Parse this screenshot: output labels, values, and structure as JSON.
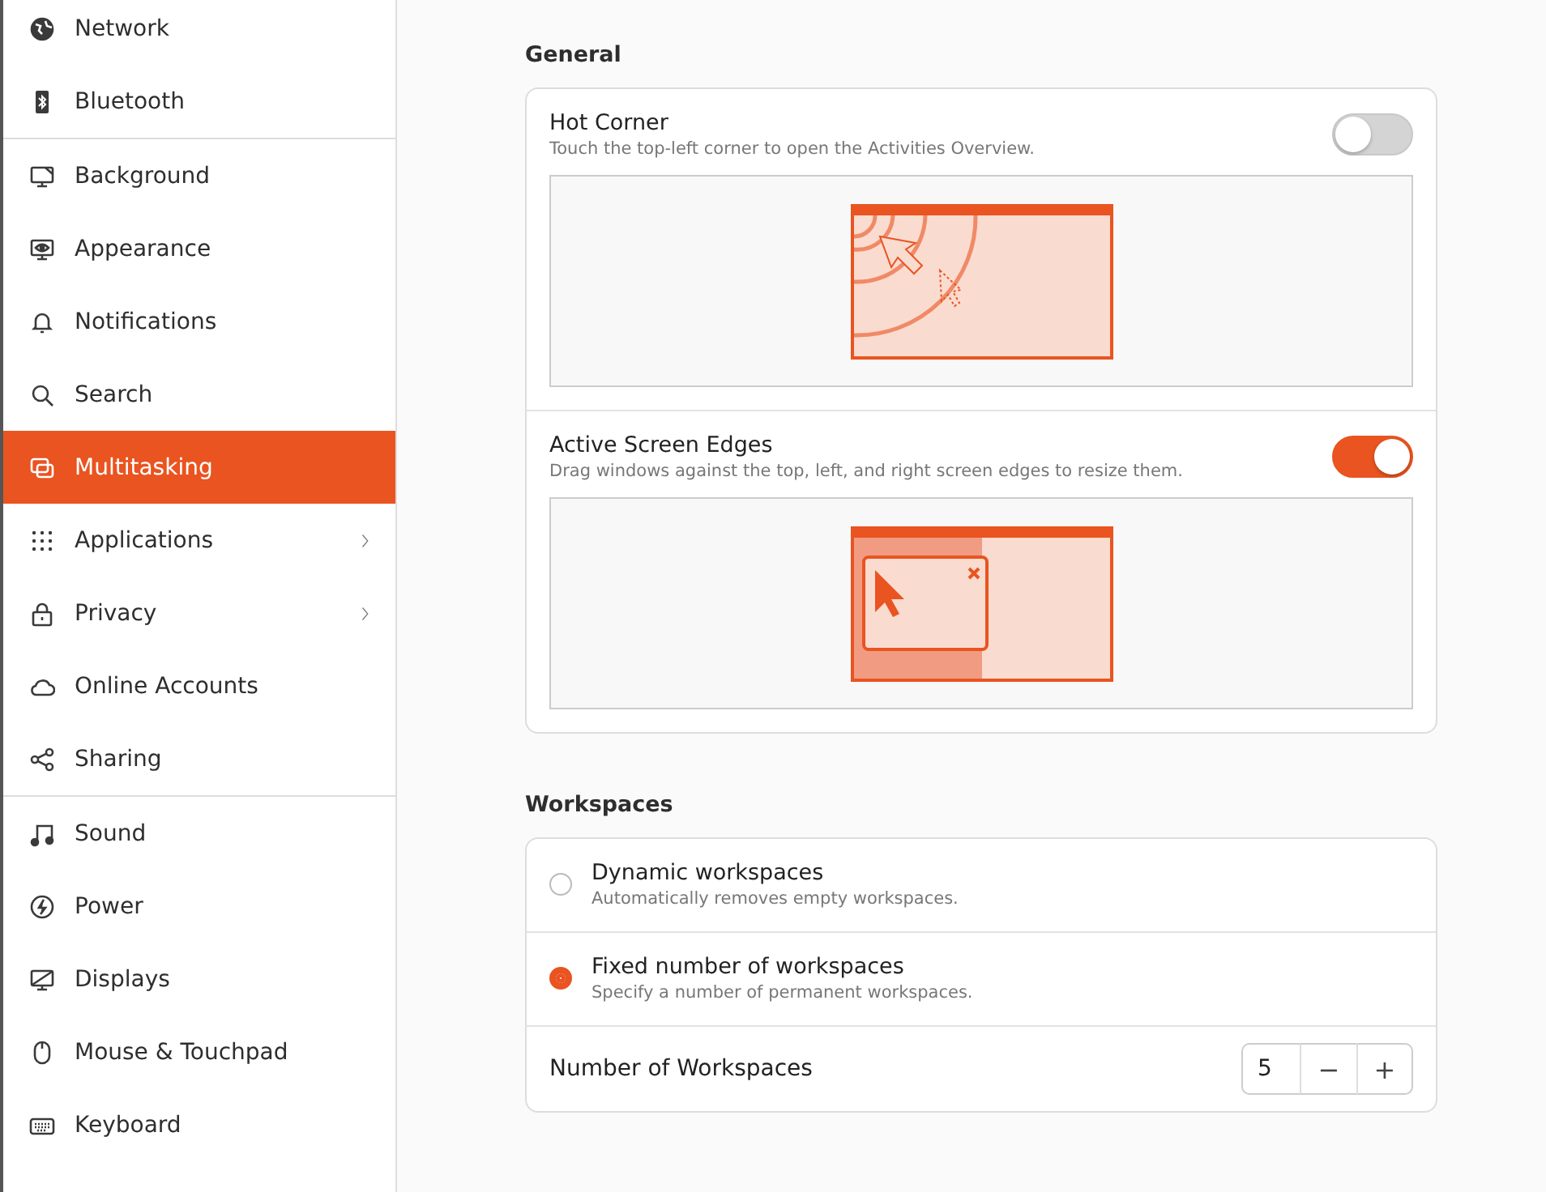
{
  "sidebar": {
    "items": [
      {
        "label": "Network",
        "selected": false,
        "has_submenu": false,
        "divider_after": false
      },
      {
        "label": "Bluetooth",
        "selected": false,
        "has_submenu": false,
        "divider_after": true
      },
      {
        "label": "Background",
        "selected": false,
        "has_submenu": false,
        "divider_after": false
      },
      {
        "label": "Appearance",
        "selected": false,
        "has_submenu": false,
        "divider_after": false
      },
      {
        "label": "Notifications",
        "selected": false,
        "has_submenu": false,
        "divider_after": false
      },
      {
        "label": "Search",
        "selected": false,
        "has_submenu": false,
        "divider_after": false
      },
      {
        "label": "Multitasking",
        "selected": true,
        "has_submenu": false,
        "divider_after": false
      },
      {
        "label": "Applications",
        "selected": false,
        "has_submenu": true,
        "divider_after": false
      },
      {
        "label": "Privacy",
        "selected": false,
        "has_submenu": true,
        "divider_after": false
      },
      {
        "label": "Online Accounts",
        "selected": false,
        "has_submenu": false,
        "divider_after": false
      },
      {
        "label": "Sharing",
        "selected": false,
        "has_submenu": false,
        "divider_after": true
      },
      {
        "label": "Sound",
        "selected": false,
        "has_submenu": false,
        "divider_after": false
      },
      {
        "label": "Power",
        "selected": false,
        "has_submenu": false,
        "divider_after": false
      },
      {
        "label": "Displays",
        "selected": false,
        "has_submenu": false,
        "divider_after": false
      },
      {
        "label": "Mouse & Touchpad",
        "selected": false,
        "has_submenu": false,
        "divider_after": false
      },
      {
        "label": "Keyboard",
        "selected": false,
        "has_submenu": false,
        "divider_after": false
      }
    ]
  },
  "sections": [
    {
      "title": "General",
      "rows": [
        {
          "kind": "toggle",
          "title": "Hot Corner",
          "subtitle": "Touch the top-left corner to open the Activities Overview.",
          "on": false,
          "has_illustration": true
        },
        {
          "kind": "toggle",
          "title": "Active Screen Edges",
          "subtitle": "Drag windows against the top, left, and right screen edges to resize them.",
          "on": true,
          "has_illustration": true
        }
      ]
    },
    {
      "title": "Workspaces",
      "rows": [
        {
          "kind": "radio",
          "title": "Dynamic workspaces",
          "subtitle": "Automatically removes empty workspaces.",
          "selected": false
        },
        {
          "kind": "radio",
          "title": "Fixed number of workspaces",
          "subtitle": "Specify a number of permanent workspaces.",
          "selected": true
        },
        {
          "kind": "spin",
          "title": "Number of Workspaces",
          "value": "5",
          "minus": "−",
          "plus": "+"
        }
      ]
    }
  ]
}
